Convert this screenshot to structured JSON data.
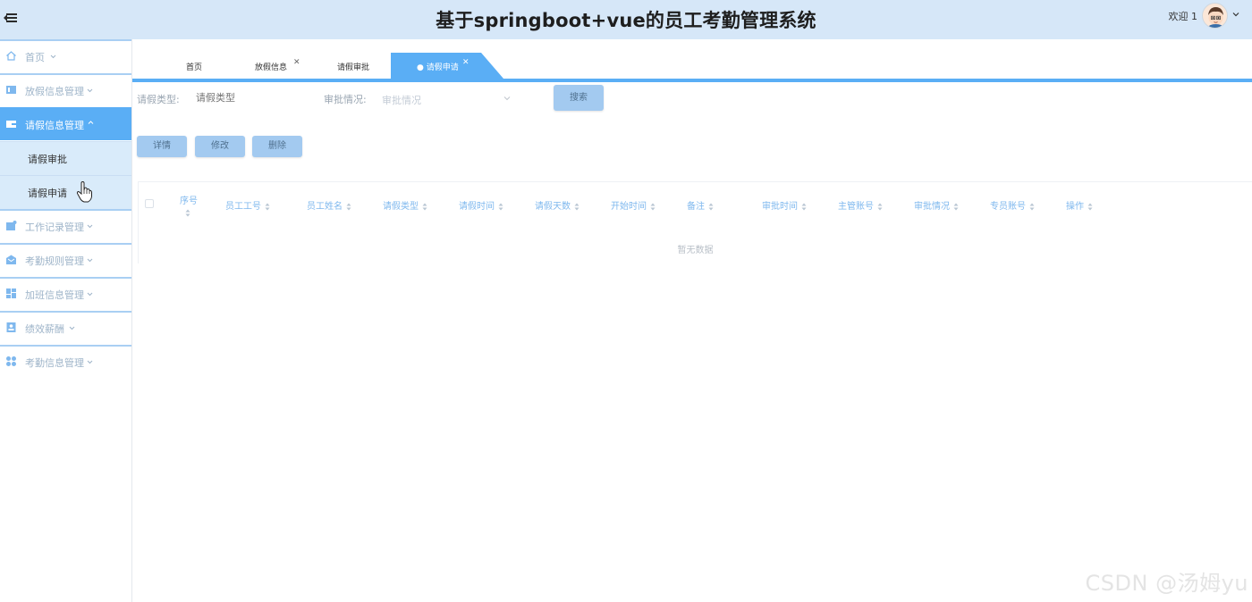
{
  "header": {
    "title": "基于springboot+vue的员工考勤管理系统",
    "welcome": "欢迎 1"
  },
  "sidebar": {
    "items": [
      {
        "label": "首页",
        "icon": "home-icon"
      },
      {
        "label": "放假信息管理",
        "icon": "calendar-icon"
      },
      {
        "label": "请假信息管理",
        "icon": "wallet-icon",
        "expanded": true
      },
      {
        "label": "工作记录管理",
        "icon": "briefcase-icon"
      },
      {
        "label": "考勤规则管理",
        "icon": "envelope-icon"
      },
      {
        "label": "加班信息管理",
        "icon": "grid-icon"
      },
      {
        "label": "绩效薪酬",
        "icon": "id-card-icon"
      },
      {
        "label": "考勤信息管理",
        "icon": "apps-icon"
      }
    ],
    "submenu": [
      {
        "label": "请假审批"
      },
      {
        "label": "请假申请"
      }
    ]
  },
  "tabs": [
    {
      "label": "首页"
    },
    {
      "label": "放假信息",
      "closable": true
    },
    {
      "label": "请假审批"
    },
    {
      "label": "● 请假申请",
      "closable": true,
      "active": true
    }
  ],
  "filters": {
    "type_label": "请假类型:",
    "type_placeholder": "请假类型",
    "status_label": "审批情况:",
    "status_placeholder": "审批情况",
    "search_button": "搜索"
  },
  "actions": {
    "detail": "详情",
    "edit": "修改",
    "delete": "删除"
  },
  "table": {
    "columns": [
      "序号",
      "员工工号",
      "员工姓名",
      "请假类型",
      "请假时间",
      "请假天数",
      "开始时间",
      "备注",
      "审批时间",
      "主管账号",
      "审批情况",
      "专员账号",
      "操作"
    ],
    "empty_text": "暂无数据"
  },
  "watermark": "CSDN @汤姆yu",
  "colors": {
    "accent": "#5aaef5",
    "header_bg": "#d6e7f8",
    "submenu_bg": "#d9ebfa"
  }
}
